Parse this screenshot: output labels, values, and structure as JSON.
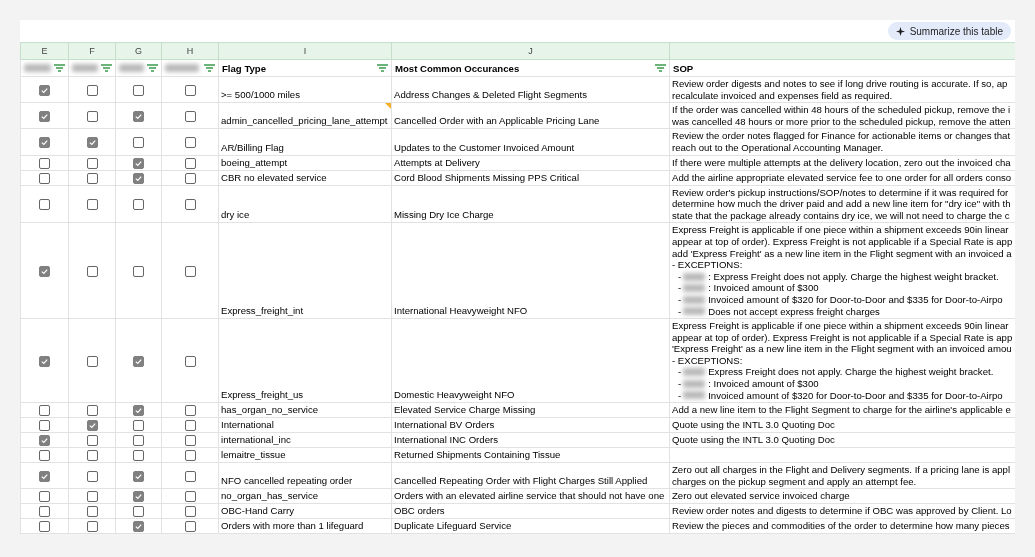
{
  "toolbar": {
    "summarize_button": "Summarize this table"
  },
  "columns": [
    {
      "letter": "E",
      "redacted": true,
      "filter": true
    },
    {
      "letter": "F",
      "redacted": true,
      "filter": true
    },
    {
      "letter": "G",
      "redacted": true,
      "filter": true
    },
    {
      "letter": "H",
      "redacted": true,
      "filter": true
    },
    {
      "letter": "I",
      "redacted": false,
      "header": "Flag Type",
      "filter": true
    },
    {
      "letter": "J",
      "redacted": false,
      "header": "Most Common Occurances",
      "filter": true
    },
    {
      "redacted": false,
      "header": "SOP",
      "filter": false
    }
  ],
  "rows": [
    {
      "checks": [
        true,
        false,
        false,
        false
      ],
      "flag": ">= 500/1000 miles",
      "note": false,
      "occurrence": "Address Changes & Deleted Flight Segments",
      "sop": [
        {
          "kind": "text",
          "text": "Review order digests and notes to see if long drive routing is accurate. If so, ap"
        },
        {
          "kind": "text",
          "text": "recalculate invoiced and expenses field as required."
        }
      ]
    },
    {
      "checks": [
        true,
        false,
        true,
        false
      ],
      "flag": "admin_cancelled_pricing_lane_attempt",
      "note": true,
      "occurrence": "Cancelled Order with an Applicable Pricing Lane",
      "sop": [
        {
          "kind": "text",
          "text": "If the order was cancelled within 48 hours of the scheduled pickup, remove the i"
        },
        {
          "kind": "text",
          "text": "was cancelled 48 hours or more prior to the scheduled pickup, remove the atten"
        }
      ]
    },
    {
      "checks": [
        true,
        true,
        false,
        false
      ],
      "flag": "AR/Billing Flag",
      "note": false,
      "occurrence": "Updates to the Customer Invoiced Amount",
      "sop": [
        {
          "kind": "text",
          "text": "Review the order notes flagged for Finance for actionable items or changes that"
        },
        {
          "kind": "text",
          "text": "reach out to the Operational Accounting Manager."
        }
      ]
    },
    {
      "checks": [
        false,
        false,
        true,
        false
      ],
      "flag": "boeing_attempt",
      "note": false,
      "occurrence": "Attempts at Delivery",
      "sop": [
        {
          "kind": "text",
          "text": "If there were multiple attempts at the delivery location, zero out the invoiced cha"
        }
      ]
    },
    {
      "checks": [
        false,
        false,
        true,
        false
      ],
      "flag": "CBR no elevated service",
      "note": false,
      "occurrence": "Cord Blood Shipments Missing PPS Critical",
      "sop": [
        {
          "kind": "text",
          "text": "Add the airline appropriate elevated service fee to one order for all orders conso"
        }
      ]
    },
    {
      "checks": [
        false,
        false,
        false,
        false
      ],
      "flag": "dry ice",
      "note": false,
      "occurrence": "Missing Dry Ice Charge",
      "sop": [
        {
          "kind": "text",
          "text": "Review order's pickup instructions/SOP/notes to determine if it was required for"
        },
        {
          "kind": "text",
          "text": "determine how much the driver paid and add a new line item for \"dry ice\" with th"
        },
        {
          "kind": "text",
          "text": "state that the package already contains dry ice, we will not need to charge the c"
        }
      ]
    },
    {
      "checks": [
        true,
        false,
        false,
        false
      ],
      "flag": "Express_freight_int",
      "note": false,
      "occurrence": "International Heavyweight NFO",
      "sop": [
        {
          "kind": "text",
          "text": "Express Freight is applicable if one piece within a shipment exceeds 90in linear"
        },
        {
          "kind": "text",
          "text": "appear at top of order). Express Freight is not applicable if a Special Rate is app"
        },
        {
          "kind": "text",
          "text": "add 'Express Freight' as a new line item in the Flight segment with an invoiced a"
        },
        {
          "kind": "text",
          "text": "- EXCEPTIONS:"
        },
        {
          "kind": "exception",
          "dash": "-",
          "text": ": Express Freight does not apply. Charge the highest weight bracket."
        },
        {
          "kind": "exception",
          "dash": "-",
          "text": ": Invoiced amount of $300"
        },
        {
          "kind": "exception",
          "dash": "-",
          "text": "Invoiced amount of $320 for Door-to-Door and $335 for Door-to-Airpo"
        },
        {
          "kind": "exception",
          "dash": "-",
          "text": "Does not accept express freight charges"
        }
      ]
    },
    {
      "checks": [
        true,
        false,
        true,
        false
      ],
      "flag": "Express_freight_us",
      "note": false,
      "occurrence": "Domestic Heavyweight NFO",
      "sop": [
        {
          "kind": "text",
          "text": "Express Freight is applicable if one piece within a shipment exceeds 90in linear"
        },
        {
          "kind": "text",
          "text": "appear at top of order). Express Freight is not applicable if a Special Rate is app"
        },
        {
          "kind": "text",
          "text": "'Express Freight' as a new line item in the Flight segment with an invoiced amou"
        },
        {
          "kind": "text",
          "text": "- EXCEPTIONS:"
        },
        {
          "kind": "exception",
          "dash": "-",
          "text": "Express Freight does not apply. Charge the highest weight bracket."
        },
        {
          "kind": "exception",
          "dash": "-",
          "text": ": Invoiced amount of $300"
        },
        {
          "kind": "exception",
          "dash": "-",
          "text": "Invoiced amount of $320 for Door-to-Door and $335 for Door-to-Airpo"
        }
      ]
    },
    {
      "checks": [
        false,
        false,
        true,
        false
      ],
      "flag": "has_organ_no_service",
      "note": false,
      "occurrence": "Elevated Service Charge Missing",
      "sop": [
        {
          "kind": "text",
          "text": "Add a new line item to the Flight Segment to charge for the airline's applicable e"
        }
      ]
    },
    {
      "checks": [
        false,
        true,
        false,
        false
      ],
      "flag": "International",
      "note": false,
      "occurrence": "International BV Orders",
      "sop": [
        {
          "kind": "text",
          "text": "Quote using the INTL 3.0 Quoting Doc"
        }
      ]
    },
    {
      "checks": [
        true,
        false,
        false,
        false
      ],
      "flag": "international_inc",
      "note": false,
      "occurrence": "International INC Orders",
      "sop": [
        {
          "kind": "text",
          "text": "Quote using the INTL 3.0 Quoting Doc"
        }
      ]
    },
    {
      "checks": [
        false,
        false,
        false,
        false
      ],
      "flag": "lemaitre_tissue",
      "note": false,
      "occurrence": "Returned Shipments Containing Tissue"
    },
    {
      "checks": [
        true,
        false,
        true,
        false
      ],
      "flag": "NFO cancelled repeating order",
      "note": false,
      "occurrence": "Cancelled Repeating Order with Flight Charges Still Applied",
      "sop": [
        {
          "kind": "text",
          "text": "Zero out all charges in the Flight and Delivery segments. If a pricing lane is appl"
        },
        {
          "kind": "text",
          "text": "charges on the pickup segment and apply an attempt fee."
        }
      ]
    },
    {
      "checks": [
        false,
        false,
        true,
        false
      ],
      "flag": "no_organ_has_service",
      "note": false,
      "occurrence": "Orders with an elevated airline service that should not have one",
      "sop": [
        {
          "kind": "text",
          "text": "Zero out elevated service invoiced charge"
        }
      ]
    },
    {
      "checks": [
        false,
        false,
        false,
        false
      ],
      "flag": "OBC-Hand Carry",
      "note": false,
      "occurrence": "OBC orders",
      "sop": [
        {
          "kind": "text",
          "text": "Review order notes and digests to determine if OBC was approved by Client. Lo"
        }
      ]
    },
    {
      "checks": [
        false,
        false,
        true,
        false
      ],
      "flag": "Orders with more than 1 lifeguard",
      "note": false,
      "occurrence": "Duplicate Lifeguard Service",
      "sop": [
        {
          "kind": "text",
          "text": "Review the pieces and commodities of the order to determine how many pieces"
        }
      ]
    }
  ]
}
